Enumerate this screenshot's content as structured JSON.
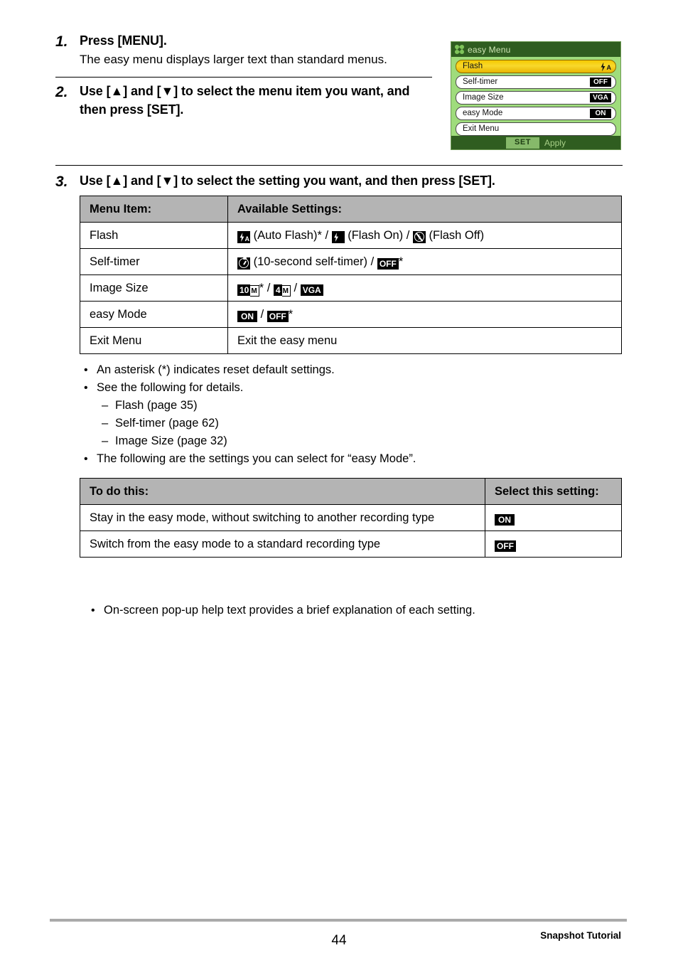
{
  "steps": [
    {
      "number": "1.",
      "title": "Press [MENU].",
      "desc": "The easy menu displays larger text than standard menus."
    },
    {
      "number": "2.",
      "title": "Use [▲] and [▼] to select the menu item you want, and then press [SET]."
    },
    {
      "number": "3.",
      "title": "Use [▲] and [▼] to select the setting you want, and then press [SET]."
    }
  ],
  "lcd": {
    "title": "easy Menu",
    "icon": "clover-icon",
    "rows": [
      {
        "label": "Flash",
        "value": "flash-auto-icon",
        "value_text": "",
        "selected": true
      },
      {
        "label": "Self-timer",
        "value": "badge",
        "value_text": "OFF",
        "selected": false
      },
      {
        "label": "Image Size",
        "value": "badge",
        "value_text": "VGA",
        "selected": false
      },
      {
        "label": "easy Mode",
        "value": "badge",
        "value_text": "ON",
        "selected": false
      },
      {
        "label": "Exit Menu",
        "value": "none",
        "value_text": "",
        "selected": false
      }
    ],
    "footer_button": "SET",
    "footer_action": "Apply",
    "colors": {
      "background": "#9fdc7c",
      "title_bar": "#2f5d20",
      "selected_row": "#f5c900",
      "row_background": "#ffffff"
    }
  },
  "table1": {
    "headers": [
      "Menu Item:",
      "Available Settings:"
    ],
    "rows": [
      {
        "item": "Flash",
        "parts": [
          {
            "kind": "icon",
            "icon": "flash-auto-icon"
          },
          {
            "kind": "text",
            "text": " (Auto Flash)* / "
          },
          {
            "kind": "icon",
            "icon": "flash-on-icon"
          },
          {
            "kind": "text",
            "text": " (Flash On) / "
          },
          {
            "kind": "icon",
            "icon": "flash-off-icon"
          },
          {
            "kind": "text",
            "text": " (Flash Off)"
          }
        ]
      },
      {
        "item": "Self-timer",
        "parts": [
          {
            "kind": "icon",
            "icon": "self-timer-icon"
          },
          {
            "kind": "text",
            "text": " (10-second self-timer) / "
          },
          {
            "kind": "badge",
            "text": "OFF"
          },
          {
            "kind": "text",
            "text": "*"
          }
        ]
      },
      {
        "item": "Image Size",
        "parts": [
          {
            "kind": "size",
            "num": "10",
            "suffix": "M"
          },
          {
            "kind": "text",
            "text": "* / "
          },
          {
            "kind": "size",
            "num": "4",
            "suffix": "M"
          },
          {
            "kind": "text",
            "text": " / "
          },
          {
            "kind": "badge",
            "text": "VGA"
          }
        ]
      },
      {
        "item": "easy Mode",
        "parts": [
          {
            "kind": "badge",
            "text": "ON"
          },
          {
            "kind": "text",
            "text": " / "
          },
          {
            "kind": "badge",
            "text": "OFF"
          },
          {
            "kind": "text",
            "text": "*"
          }
        ]
      },
      {
        "item": "Exit Menu",
        "parts": [
          {
            "kind": "text",
            "text": "Exit the easy menu"
          }
        ]
      }
    ]
  },
  "notes1": [
    {
      "type": "bullet",
      "marker": "•",
      "text": "An asterisk (*) indicates reset default settings."
    },
    {
      "type": "bullet",
      "marker": "•",
      "text": "See the following for details."
    },
    {
      "type": "dash",
      "marker": "–",
      "text": "Flash (page 35)"
    },
    {
      "type": "dash",
      "marker": "–",
      "text": "Self-timer (page 62)"
    },
    {
      "type": "dash",
      "marker": "–",
      "text": "Image Size (page 32)"
    },
    {
      "type": "bullet",
      "marker": "•",
      "text": "The following are the settings you can select for “easy Mode”."
    }
  ],
  "table2": {
    "headers": [
      "To do this:",
      "Select this setting:"
    ],
    "rows": [
      {
        "description": "Stay in the easy mode, without switching to another recording type",
        "setting": "ON"
      },
      {
        "description": "Switch from the easy mode to a standard recording type",
        "setting": "OFF"
      }
    ]
  },
  "notes2": [
    {
      "type": "bullet",
      "marker": "•",
      "text": "On-screen pop-up help text provides a brief explanation of each setting."
    }
  ],
  "footer": {
    "page_number": "44",
    "section": "Snapshot Tutorial"
  }
}
